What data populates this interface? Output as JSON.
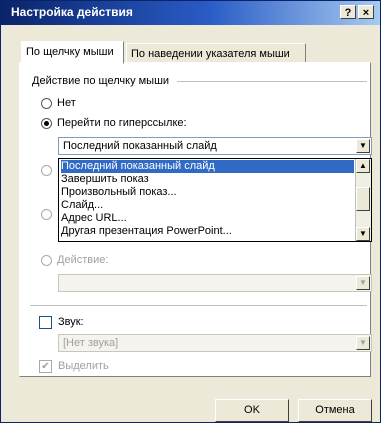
{
  "window": {
    "title": "Настройка действия",
    "help_glyph": "?",
    "close_glyph": "×"
  },
  "tabs": [
    {
      "label": "По щелчку мыши",
      "active": true
    },
    {
      "label": "По наведении указателя мыши",
      "active": false
    }
  ],
  "group": {
    "label": "Действие по щелчку мыши"
  },
  "options": {
    "none": "Нет",
    "hyperlink": "Перейти по гиперссылке:",
    "action": "Действие:"
  },
  "hyperlink_combo": {
    "value": "Последний показанный слайд"
  },
  "dropdown_items": [
    "Последний показанный слайд",
    "Завершить показ",
    "Произвольный показ...",
    "Слайд...",
    "Адрес URL...",
    "Другая презентация PowerPoint..."
  ],
  "action_combo": {
    "value": ""
  },
  "sound": {
    "label": "Звук:",
    "value": "[Нет звука]",
    "checked": false
  },
  "highlight": {
    "label": "Выделить",
    "checked": true
  },
  "buttons": {
    "ok": "OK",
    "cancel": "Отмена"
  },
  "icons": {
    "arrow_down": "▼",
    "arrow_up": "▲",
    "check": "✔"
  }
}
